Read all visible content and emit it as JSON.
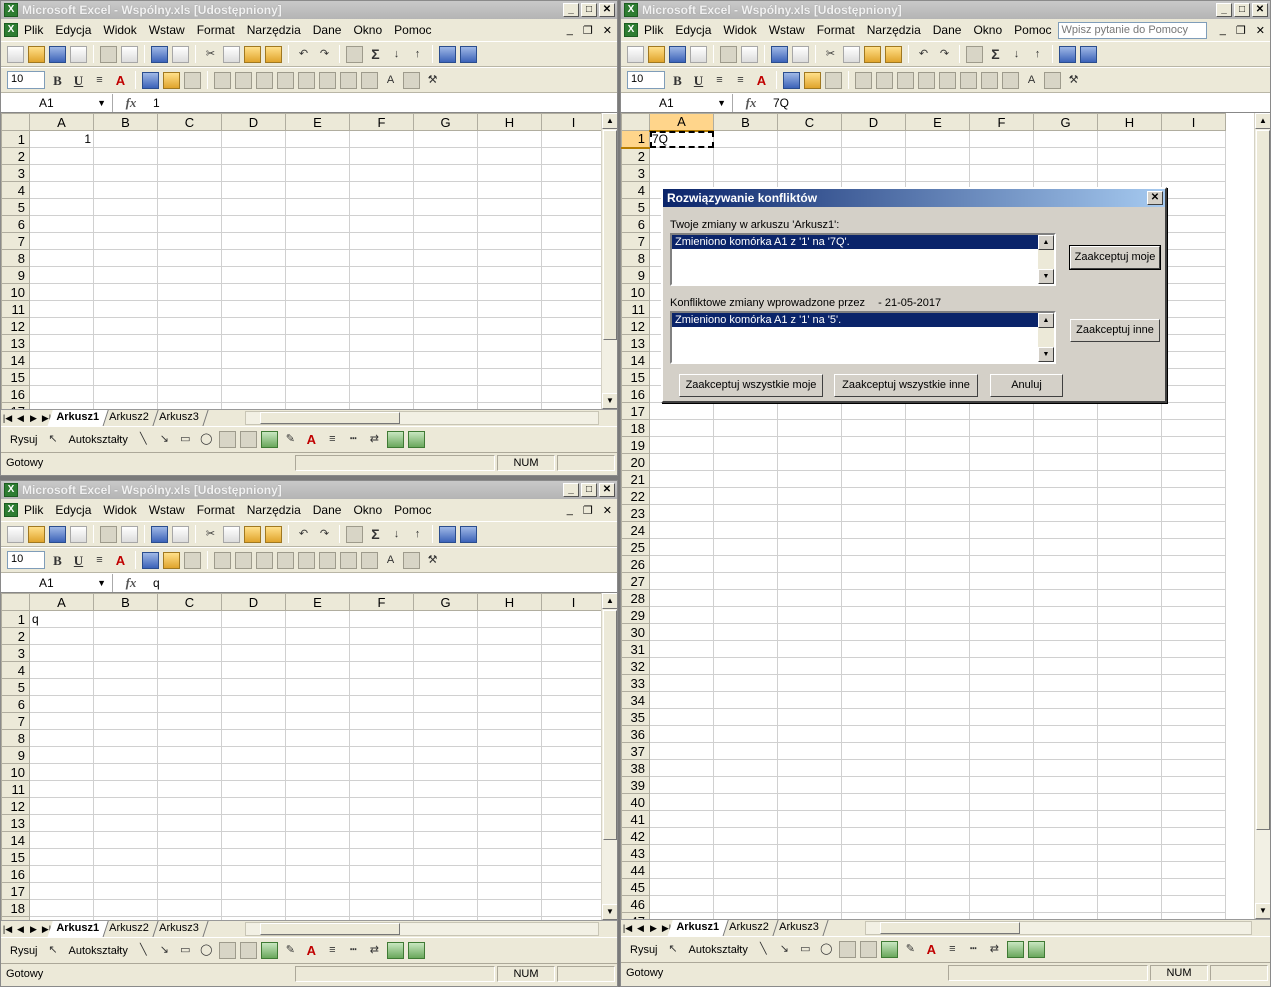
{
  "app": {
    "title": "Microsoft Excel - Wspólny.xls  [Udostępniony]",
    "menu": [
      "Plik",
      "Edycja",
      "Widok",
      "Wstaw",
      "Format",
      "Narzędzia",
      "Dane",
      "Okno",
      "Pomoc"
    ],
    "help_placeholder": "Wpisz pytanie do Pomocy",
    "font_size": "10",
    "cell_ref": "A1",
    "fx": "fx",
    "columns": [
      "A",
      "B",
      "C",
      "D",
      "E",
      "F",
      "G",
      "H",
      "I"
    ],
    "sheets": [
      "Arkusz1",
      "Arkusz2",
      "Arkusz3"
    ],
    "draw_label": "Rysuj",
    "autoshapes_label": "Autokształty",
    "status": "Gotowy",
    "num": "NUM"
  },
  "windows": {
    "top_left": {
      "formula_value": "1",
      "a1_value": "1"
    },
    "bottom_left": {
      "formula_value": "q",
      "a1_value": "q"
    },
    "right": {
      "formula_value": "7Q",
      "a1_value": "7Q"
    }
  },
  "dialog": {
    "title": "Rozwiązywanie konfliktów",
    "your_changes_label": "Twoje zmiany w arkuszu 'Arkusz1':",
    "your_change_item": "Zmieniono komórka A1 z '1' na '7Q'.",
    "conflict_label": "Konfliktowe zmiany wprowadzone przez",
    "conflict_date": "- 21-05-2017",
    "conflict_item": "Zmieniono komórka A1 z '1' na '5'.",
    "accept_mine": "Zaakceptuj moje",
    "accept_other": "Zaakceptuj inne",
    "accept_all_mine": "Zaakceptuj wszystkie moje",
    "accept_all_other": "Zaakceptuj wszystkie inne",
    "cancel": "Anuluj"
  }
}
